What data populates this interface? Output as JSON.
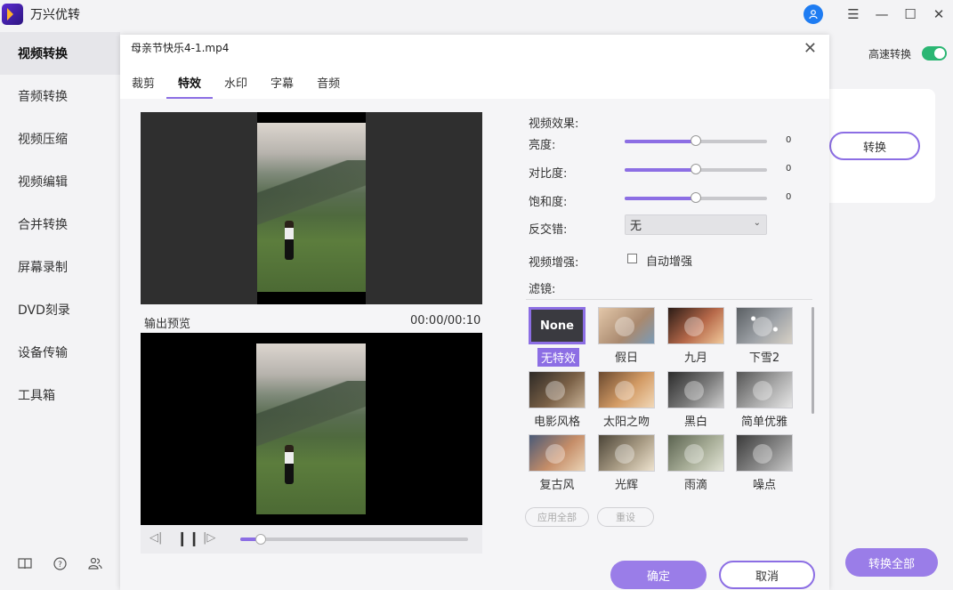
{
  "app": {
    "title": "万兴优转",
    "user_icon": "user-icon"
  },
  "window": {
    "menu_icon": "☰",
    "min_icon": "—",
    "max_icon": "☐",
    "close_icon": "✕"
  },
  "sidebar": {
    "items": [
      {
        "label": "视频转换",
        "active": true
      },
      {
        "label": "音频转换"
      },
      {
        "label": "视频压缩"
      },
      {
        "label": "视频编辑"
      },
      {
        "label": "合并转换"
      },
      {
        "label": "屏幕录制"
      },
      {
        "label": "DVD刻录"
      },
      {
        "label": "设备传输"
      },
      {
        "label": "工具箱"
      }
    ],
    "bottom_icons": [
      "book-icon",
      "help-icon",
      "users-icon"
    ]
  },
  "background": {
    "high_speed_label": "高速转换",
    "high_speed_on": true,
    "convert_label": "转换",
    "convert_all_label": "转换全部"
  },
  "dialog": {
    "title": "母亲节快乐4-1.mp4",
    "tabs": [
      {
        "label": "裁剪"
      },
      {
        "label": "特效",
        "active": true
      },
      {
        "label": "水印"
      },
      {
        "label": "字幕"
      },
      {
        "label": "音频"
      }
    ],
    "preview_label": "输出预览",
    "time": "00:00/00:10",
    "playback_progress": 0.09,
    "effects": {
      "section_label": "视频效果:",
      "brightness_label": "亮度:",
      "brightness_value": "0",
      "contrast_label": "对比度:",
      "contrast_value": "0",
      "saturation_label": "饱和度:",
      "saturation_value": "0",
      "deinterlace_label": "反交错:",
      "deinterlace_value": "无",
      "enhance_label": "视频增强:",
      "auto_enhance_label": "自动增强",
      "auto_enhance_checked": false,
      "filter_label": "滤镜:"
    },
    "filters": [
      {
        "label": "无特效",
        "thumb_text": "None",
        "selected": true
      },
      {
        "label": "假日",
        "tint": "#c9a58a"
      },
      {
        "label": "九月",
        "tint": "#b76a4c"
      },
      {
        "label": "下雪2",
        "tint": "#8a8e92"
      },
      {
        "label": "电影风格",
        "tint": "#6b5a45"
      },
      {
        "label": "太阳之吻",
        "tint": "#c98a56"
      },
      {
        "label": "黑白",
        "tint": "#7a7a7a"
      },
      {
        "label": "简单优雅",
        "tint": "#a7a7a7"
      },
      {
        "label": "复古风",
        "tint": "#b8866b"
      },
      {
        "label": "光辉",
        "tint": "#a89b84"
      },
      {
        "label": "雨滴",
        "tint": "#9aa18d"
      },
      {
        "label": "噪点",
        "tint": "#6f6f6f"
      }
    ],
    "apply_all_label": "应用全部",
    "reset_label": "重设",
    "ok_label": "确定",
    "cancel_label": "取消"
  },
  "colors": {
    "accent": "#8c6ee4",
    "toggle_on": "#2bb673",
    "user_blue": "#1e7cf2"
  }
}
